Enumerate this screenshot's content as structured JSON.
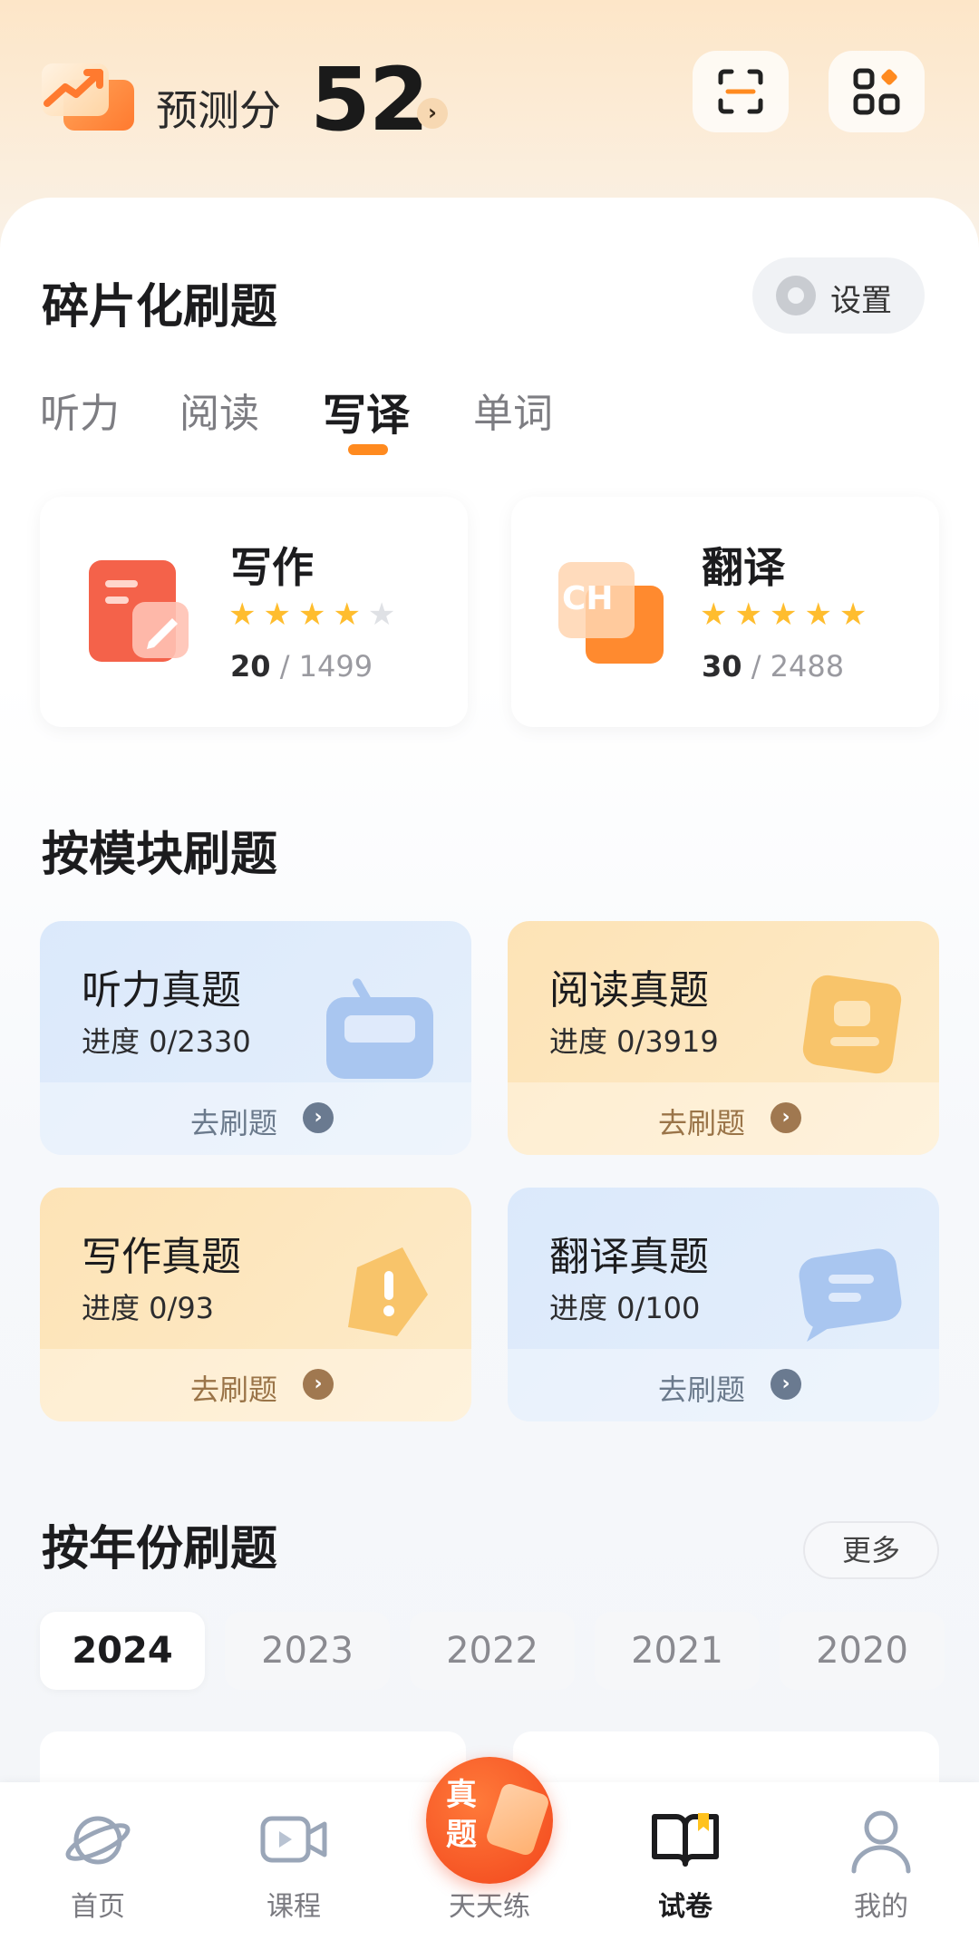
{
  "header": {
    "score_label": "预测分",
    "score_value": "52",
    "score_arrow": "›"
  },
  "fragment": {
    "title": "碎片化刷题",
    "settings_label": "设置",
    "tabs": [
      "听力",
      "阅读",
      "写译",
      "单词"
    ],
    "active_tab": "写译",
    "cards": [
      {
        "title": "写作",
        "stars_on": 4,
        "stars_total": 5,
        "done": "20",
        "total": "/ 1499"
      },
      {
        "title": "翻译",
        "stars_on": 5,
        "stars_total": 5,
        "done": "30",
        "total": "/ 2488",
        "icon_text": "CH"
      }
    ]
  },
  "modules": {
    "title": "按模块刷题",
    "go_label": "去刷题",
    "go_arrow": "›",
    "items": [
      {
        "title": "听力真题",
        "progress": "进度 0/2330"
      },
      {
        "title": "阅读真题",
        "progress": "进度 0/3919"
      },
      {
        "title": "写作真题",
        "progress": "进度 0/93"
      },
      {
        "title": "翻译真题",
        "progress": "进度 0/100"
      }
    ]
  },
  "years": {
    "title": "按年份刷题",
    "more_label": "更多",
    "chips": [
      "2024",
      "2023",
      "2022",
      "2021",
      "2020"
    ],
    "active": "2024"
  },
  "center_button": {
    "text": "真题"
  },
  "tabbar": [
    {
      "label": "首页",
      "icon": "planet-icon"
    },
    {
      "label": "课程",
      "icon": "video-icon"
    },
    {
      "label": "天天练",
      "icon": "center-practice"
    },
    {
      "label": "试卷",
      "icon": "book-icon",
      "active": true
    },
    {
      "label": "我的",
      "icon": "person-icon"
    }
  ],
  "colors": {
    "accent": "#ff8a1f",
    "star": "#ffbd2e",
    "center_button": "#f2461c"
  }
}
